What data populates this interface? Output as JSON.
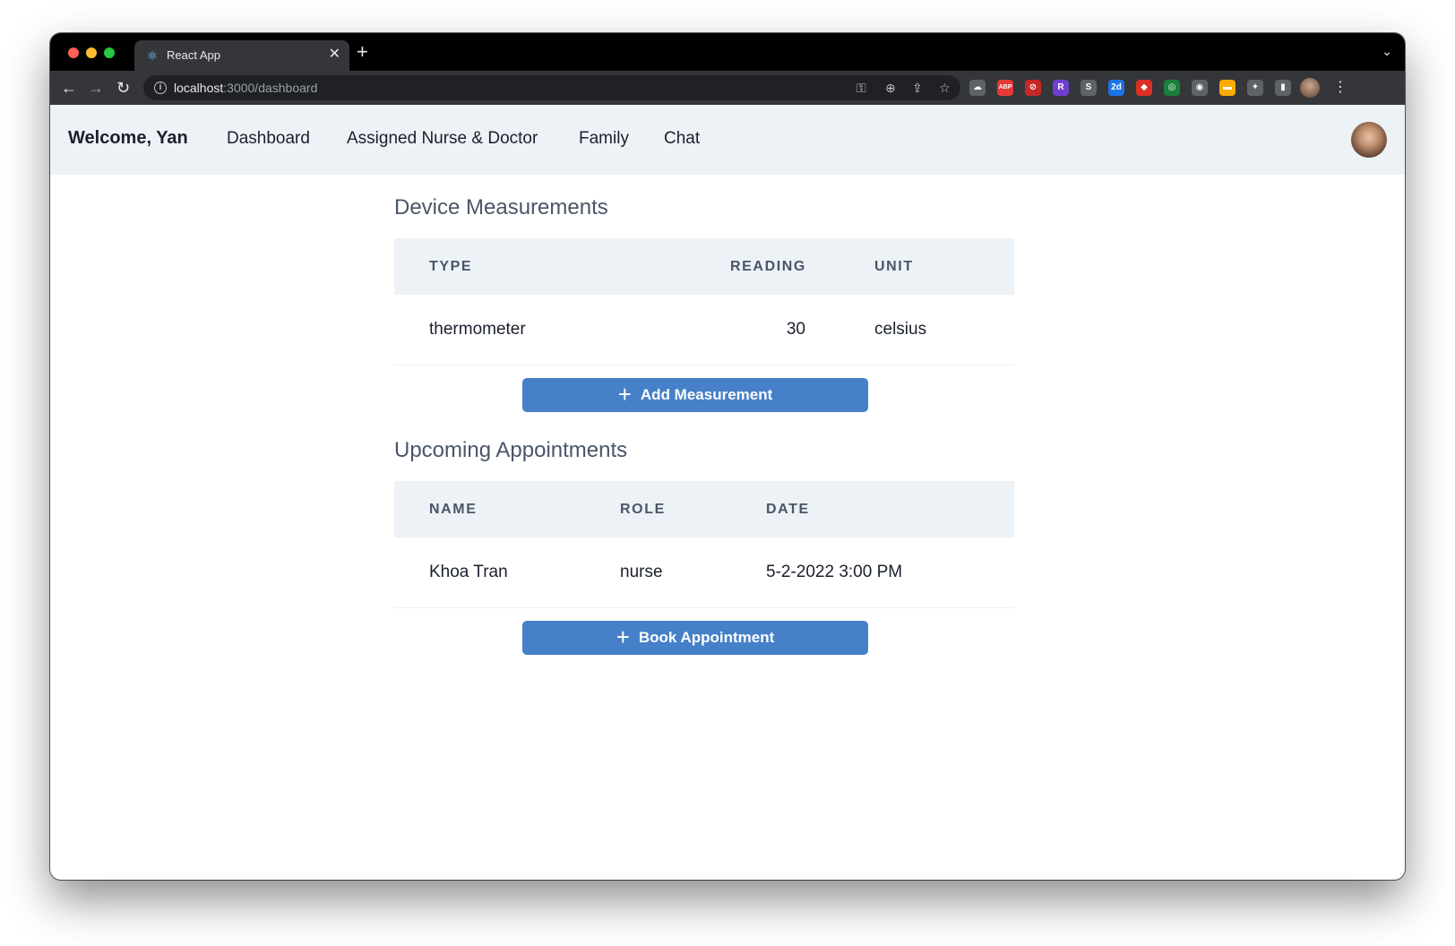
{
  "browser": {
    "tab_title": "React App",
    "tab_favicon": "react-icon",
    "url_host": "localhost",
    "url_rest": ":3000/dashboard",
    "new_tab_symbol": "+",
    "close_symbol": "✕",
    "extensions": [
      {
        "name": "cloud-extension-icon",
        "label": "☁",
        "color": "#5f6368"
      },
      {
        "name": "adblock-extension-icon",
        "label": "ABP",
        "color": "#e53935"
      },
      {
        "name": "blocked-extension-icon",
        "label": "⊘",
        "color": "#c62828"
      },
      {
        "name": "r-extension-icon",
        "label": "R",
        "color": "#6f3fd0"
      },
      {
        "name": "s-extension-icon",
        "label": "S",
        "color": "#5f6368"
      },
      {
        "name": "calendar-extension-icon",
        "label": "2d",
        "color": "#1a73e8"
      },
      {
        "name": "red-extension-icon",
        "label": "◆",
        "color": "#d93025"
      },
      {
        "name": "ring-extension-icon",
        "label": "◎",
        "color": "#188038"
      },
      {
        "name": "camera-extension-icon",
        "label": "◉",
        "color": "#5f6368"
      },
      {
        "name": "notes-extension-icon",
        "label": "▬",
        "color": "#f9ab00"
      },
      {
        "name": "puzzle-extension-icon",
        "label": "✦",
        "color": "#5f6368"
      },
      {
        "name": "sidepanel-extension-icon",
        "label": "▮",
        "color": "#5f6368"
      }
    ]
  },
  "navbar": {
    "welcome": "Welcome, Yan",
    "links": [
      "Dashboard",
      "Assigned Nurse & Doctor",
      "Family",
      "Chat"
    ]
  },
  "measurements": {
    "title": "Device Measurements",
    "columns": [
      "TYPE",
      "READING",
      "UNIT"
    ],
    "rows": [
      {
        "type": "thermometer",
        "reading": "30",
        "unit": "celsius"
      }
    ],
    "button_label": "Add Measurement",
    "button_icon": "+"
  },
  "appointments": {
    "title": "Upcoming Appointments",
    "columns": [
      "NAME",
      "ROLE",
      "DATE"
    ],
    "rows": [
      {
        "name": "Khoa Tran",
        "role": "nurse",
        "date": "5-2-2022 3:00 PM"
      }
    ],
    "button_label": "Book Appointment",
    "button_icon": "+"
  }
}
